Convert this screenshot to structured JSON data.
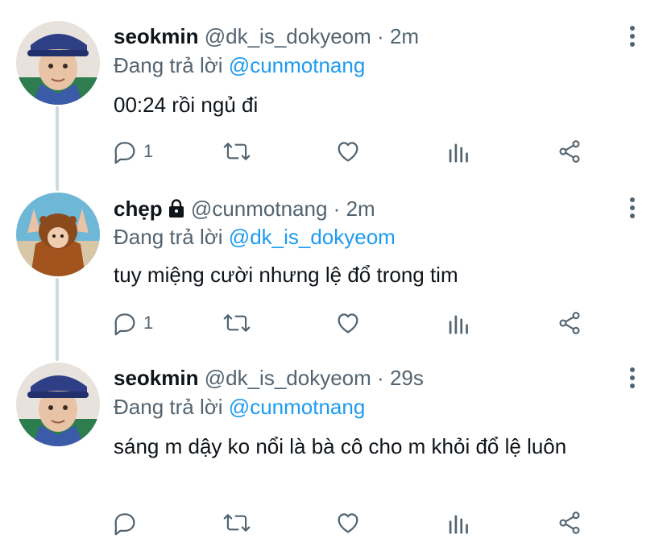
{
  "tweets": [
    {
      "name": "seokmin",
      "handle": "@dk_is_dokyeom",
      "time": "2m",
      "reply_prefix": "Đang trả lời",
      "reply_to": "@cunmotnang",
      "text": "00:24 rồi ngủ đi",
      "reply_count": "1",
      "locked": false
    },
    {
      "name": "chẹp",
      "handle": "@cunmotnang",
      "time": "2m",
      "reply_prefix": "Đang trả lời",
      "reply_to": "@dk_is_dokyeom",
      "text": "tuy miệng cười nhưng lệ đổ trong tim",
      "reply_count": "1",
      "locked": true
    },
    {
      "name": "seokmin",
      "handle": "@dk_is_dokyeom",
      "time": "29s",
      "reply_prefix": "Đang trả lời",
      "reply_to": "@cunmotnang",
      "text": "sáng m dậy ko nổi là bà cô cho m khỏi đổ lệ luôn",
      "reply_count": "",
      "locked": false
    }
  ],
  "separator": "·",
  "colors": {
    "link": "#1d9bf0",
    "muted": "#536471",
    "thread_line": "#cfd9de"
  },
  "icons": [
    "reply-icon",
    "retweet-icon",
    "like-icon",
    "analytics-icon",
    "share-icon",
    "more-icon",
    "lock-icon"
  ]
}
